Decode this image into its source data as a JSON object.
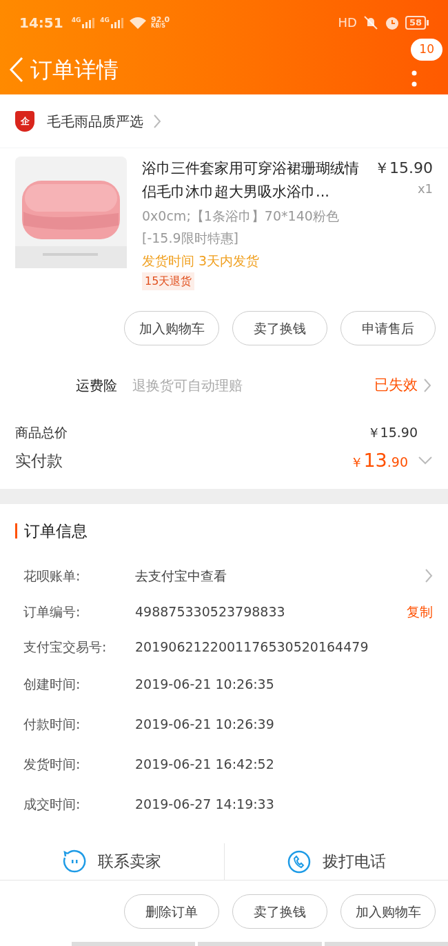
{
  "status_bar": {
    "time": "14:51",
    "networks": [
      "4G",
      "4G"
    ],
    "speed": "92.0",
    "speed_unit": "KB/S",
    "hd": "HD",
    "battery": "58"
  },
  "header": {
    "title": "订单详情",
    "badge": "10"
  },
  "store": {
    "name": "毛毛雨品质严选",
    "logo": "企"
  },
  "product": {
    "title": "浴巾三件套家用可穿浴裙珊瑚绒情侣毛巾沐巾超大男吸水浴巾...",
    "price": "￥15.90",
    "quantity": "x1",
    "spec": "0x0cm;【1条浴巾】70*140粉色",
    "promo": "[-15.9限时特惠]",
    "shipping": "发货时间 3天内发货",
    "tag": "15天退货"
  },
  "item_buttons": [
    "加入购物车",
    "卖了换钱",
    "申请售后"
  ],
  "insurance": {
    "label": "运费险",
    "description": "退换货可自动理赔",
    "status": "已失效"
  },
  "totals": {
    "goods_label": "商品总价",
    "goods_value": "￥15.90",
    "paid_label": "实付款",
    "paid_currency": "￥",
    "paid_integer": "13",
    "paid_decimal": ".90"
  },
  "order_info": {
    "title": "订单信息",
    "rows": [
      {
        "kind": "link",
        "label": "花呗账单:",
        "value": "去支付宝中查看"
      },
      {
        "kind": "copy",
        "label": "订单编号:",
        "value": "498875330523798833",
        "action": "复制"
      },
      {
        "kind": "plain",
        "label": "支付宝交易号:",
        "value": "2019062122001176530520164479"
      },
      {
        "kind": "plain",
        "label": "创建时间:",
        "value": "2019-06-21 10:26:35"
      },
      {
        "kind": "plain",
        "label": "付款时间:",
        "value": "2019-06-21 10:26:39"
      },
      {
        "kind": "plain",
        "label": "发货时间:",
        "value": "2019-06-21 16:42:52"
      },
      {
        "kind": "plain",
        "label": "成交时间:",
        "value": "2019-06-27 14:19:33"
      }
    ]
  },
  "contact": [
    {
      "kind": "chat",
      "label": "联系卖家"
    },
    {
      "kind": "phone",
      "label": "拨打电话"
    }
  ],
  "bottom_buttons": [
    "删除订单",
    "卖了换钱",
    "加入购物车"
  ]
}
